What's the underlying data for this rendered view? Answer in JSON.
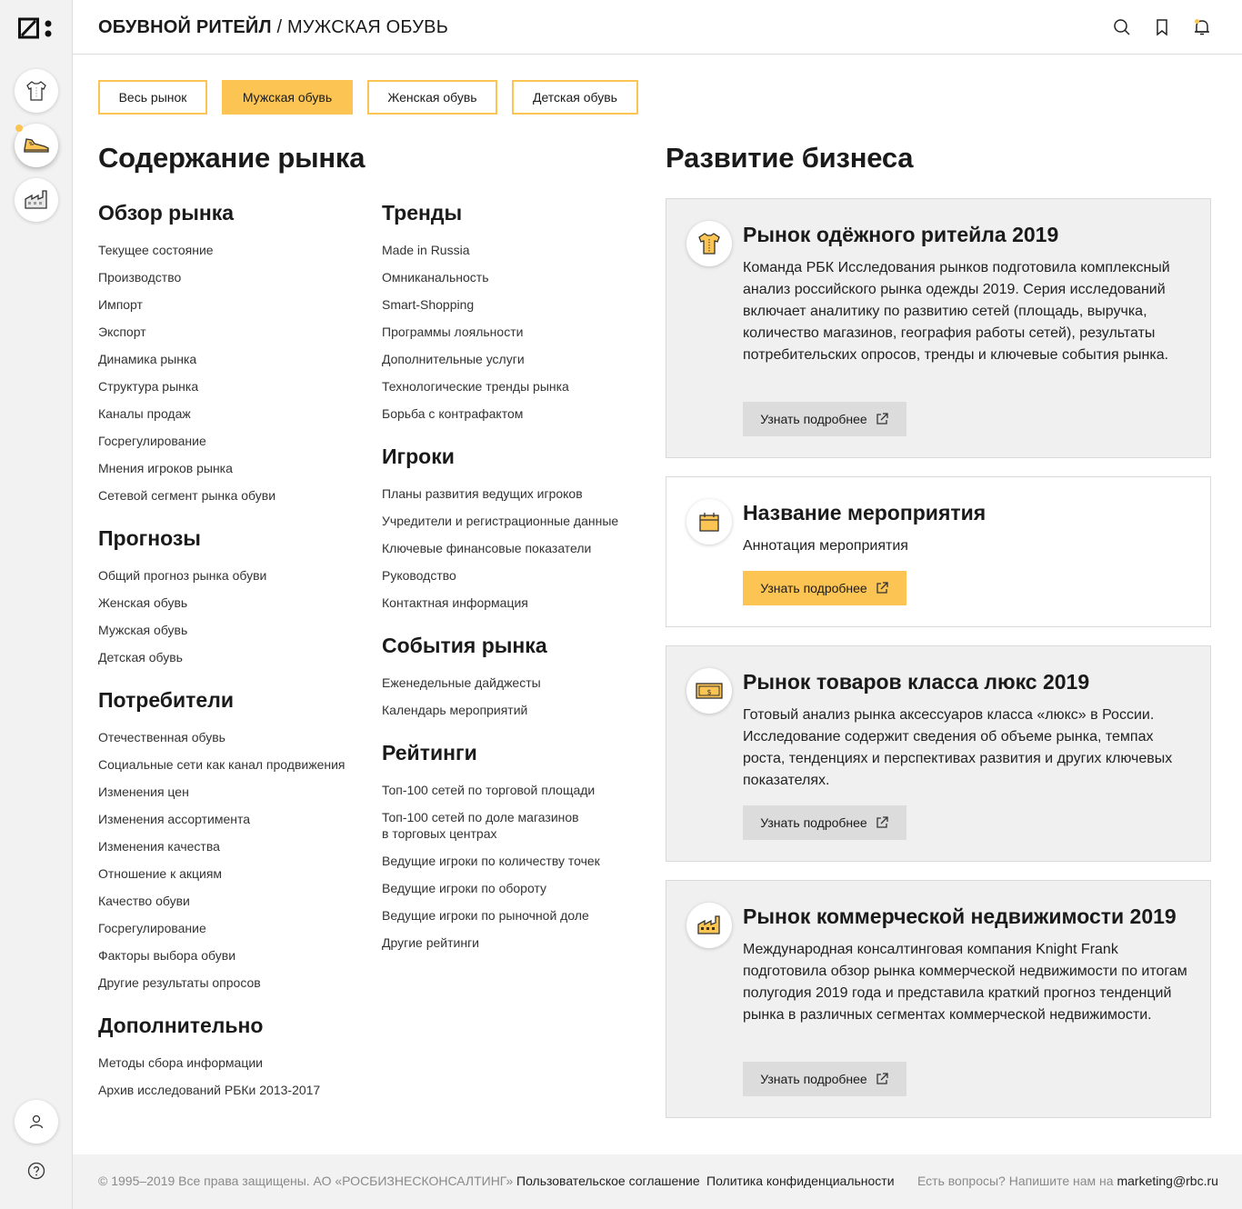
{
  "header": {
    "title_bold": "ОБУВНОЙ РИТЕЙЛ",
    "title_rest": " / МУЖСКАЯ ОБУВЬ"
  },
  "tabs": [
    {
      "label": "Весь рынок",
      "active": false
    },
    {
      "label": "Мужская обувь",
      "active": true
    },
    {
      "label": "Женская обувь",
      "active": false
    },
    {
      "label": "Детская обувь",
      "active": false
    }
  ],
  "content": {
    "heading": "Содержание рынка",
    "left": {
      "overview": {
        "title": "Обзор рынка",
        "items": [
          "Текущее состояние",
          "Производство",
          "Импорт",
          "Экспорт",
          "Динамика рынка",
          "Структура рынка",
          "Каналы продаж",
          "Госрегулирование",
          "Мнения игроков рынка",
          "Сетевой сегмент рынка обуви"
        ]
      },
      "forecasts": {
        "title": "Прогнозы",
        "items": [
          "Общий прогноз рынка обуви",
          "Женская обувь",
          "Мужская обувь",
          "Детская обувь"
        ]
      },
      "consumers": {
        "title": "Потребители",
        "items": [
          "Отечественная обувь",
          "Социальные сети как канал продвижения",
          "Изменения цен",
          "Изменения ассортимента",
          "Изменения качества",
          "Отношение к акциям",
          "Качество обуви",
          "Госрегулирование",
          "Факторы выбора обуви",
          "Другие результаты опросов"
        ]
      },
      "extra": {
        "title": "Дополнительно",
        "items": [
          "Методы сбора информации",
          "Архив исследований РБКи 2013-2017"
        ]
      }
    },
    "right": {
      "trends": {
        "title": "Тренды",
        "items": [
          "Made in Russia",
          "Омниканальность",
          "Smart-Shopping",
          "Программы лояльности",
          "Дополнительные услуги",
          "Технологические тренды рынка",
          "Борьба с контрафактом"
        ]
      },
      "players": {
        "title": "Игроки",
        "items": [
          "Планы развития ведущих игроков",
          "Учредители и регистрационные данные",
          "Ключевые финансовые показатели",
          "Руководство",
          "Контактная информация"
        ]
      },
      "events": {
        "title": "События рынка",
        "items": [
          "Еженедельные дайджесты",
          "Календарь мероприятий"
        ]
      },
      "ratings": {
        "title": "Рейтинги",
        "items": [
          "Топ-100 сетей по торговой площади",
          "Топ-100 сетей по доле магазинов в торговых центрах",
          "Ведущие игроки по количеству точек",
          "Ведущие игроки по обороту",
          "Ведущие игроки по рыночной доле",
          "Другие рейтинги"
        ]
      }
    }
  },
  "business": {
    "heading": "Развитие бизнеса",
    "cards": [
      {
        "title": "Рынок одёжного ритейла 2019",
        "text": "Команда РБК Исследования рынков подготовила комплексный анализ российского рынка одежды 2019. Серия исследований включает аналитику по развитию сетей (площадь, выручка, количество магазинов, география работы сетей), результаты потребительских опросов, тренды и ключевые события рынка.",
        "button": "Узнать подробнее",
        "icon": "shirt-icon"
      },
      {
        "title": "Название мероприятия",
        "text": "Аннотация мероприятия",
        "button": "Узнать подробнее",
        "icon": "calendar-icon"
      },
      {
        "title": "Рынок товаров класса люкс 2019",
        "text": "Готовый анализ рынка аксессуаров класса «люкс» в России. Исследование содержит сведения об объеме рынка, темпах роста, тенденциях и перспективах развития и других ключевых показателях.",
        "button": "Узнать подробнее",
        "icon": "money-icon"
      },
      {
        "title": "Рынок коммерческой недвижимости 2019",
        "text": "Международная консалтинговая компания Knight Frank подготовила обзор рынка коммерческой недвижимости по итогам полугодия 2019 года и представила краткий прогноз тенденций рынка в различных сегментах коммерческой недвижимости.",
        "button": "Узнать подробнее",
        "icon": "factory-icon"
      }
    ]
  },
  "footer": {
    "copyright": "© 1995–2019 Все права защищены. АО «РОСБИЗНЕСКОНСАЛТИНГ»",
    "agreement": "Пользовательское соглашение",
    "privacy": "Политика конфиденциальности",
    "contact_prefix": "Есть вопросы? Напишите нам на ",
    "email": "marketing@rbc.ru"
  },
  "colors": {
    "accent": "#fcc452",
    "card_bg": "#f0f0f0",
    "sidebar_bg": "#f2f2f2"
  }
}
